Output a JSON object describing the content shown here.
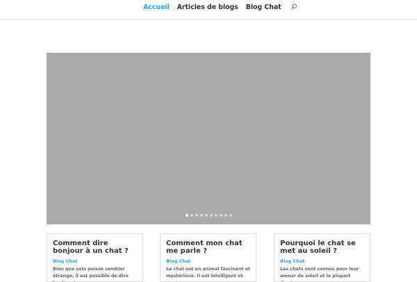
{
  "nav": {
    "items": [
      {
        "label": "Accueil",
        "active": true
      },
      {
        "label": "Articles de blogs",
        "active": false
      },
      {
        "label": "Blog Chat",
        "active": false
      }
    ],
    "search_icon": "search-icon",
    "active_color": "#2ea3f2"
  },
  "slider": {
    "background": "#ababab",
    "slide_count": 10,
    "active_index": 0
  },
  "posts": [
    {
      "title": "Comment dire bonjour à un chat ?",
      "category": "Blog Chat",
      "excerpt": "Bien que cela puisse sembler étrange, il est possible de dire bonjour à un"
    },
    {
      "title": "Comment mon chat me parle ?",
      "category": "Blog Chat",
      "excerpt": "Le chat est un animal fascinant et mystérieux. Il est intelligent et peut"
    },
    {
      "title": "Pourquoi le chat se met au soleil ?",
      "category": "Blog Chat",
      "excerpt": "Les chats sont connus pour leur amour du soleil et la plupart d'entre"
    }
  ]
}
